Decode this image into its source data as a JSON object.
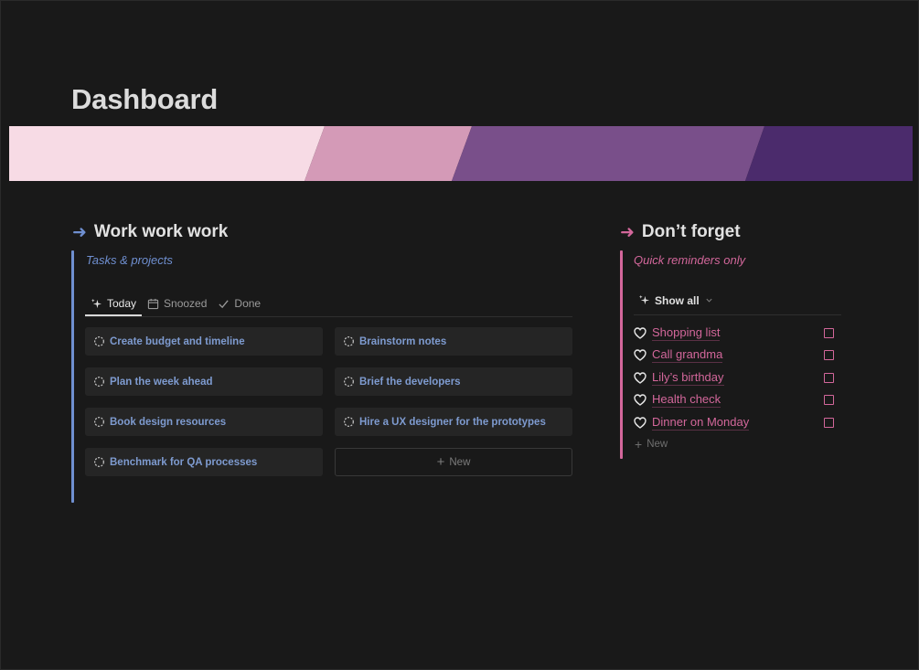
{
  "page": {
    "title": "Dashboard"
  },
  "banner": {
    "colors": [
      "#f7dbe5",
      "#d49ab7",
      "#794f8a",
      "#4b2b6c"
    ]
  },
  "work": {
    "heading": "Work work work",
    "subtitle": "Tasks & projects",
    "accent": "#6f8fd0",
    "arrow_icon": "arrow-right-icon",
    "tabs": [
      {
        "label": "Today",
        "icon": "sparkle-icon",
        "active": true
      },
      {
        "label": "Snoozed",
        "icon": "calendar-icon",
        "active": false
      },
      {
        "label": "Done",
        "icon": "checkmark-icon",
        "active": false
      }
    ],
    "cards": [
      {
        "label": "Create budget and timeline",
        "icon": "dashed-circle-icon"
      },
      {
        "label": "Brainstorm notes",
        "icon": "dashed-circle-icon"
      },
      {
        "label": "Plan the week ahead",
        "icon": "dashed-circle-icon"
      },
      {
        "label": "Brief the developers",
        "icon": "dashed-circle-icon"
      },
      {
        "label": "Book design resources",
        "icon": "dashed-circle-icon"
      },
      {
        "label": "Hire a UX designer for the prototypes",
        "icon": "dashed-circle-icon"
      },
      {
        "label": "Benchmark for QA processes",
        "icon": "dashed-circle-icon"
      }
    ],
    "new_label": "New"
  },
  "reminders": {
    "heading": "Don’t forget",
    "subtitle": "Quick reminders only",
    "accent": "#d3679b",
    "arrow_icon": "arrow-right-icon",
    "filter_label": "Show all",
    "items": [
      {
        "label": "Shopping list",
        "icon": "heart-icon",
        "checked": false
      },
      {
        "label": "Call grandma",
        "icon": "heart-icon",
        "checked": false
      },
      {
        "label": "Lily’s birthday",
        "icon": "heart-icon",
        "checked": false
      },
      {
        "label": "Health check",
        "icon": "heart-icon",
        "checked": false
      },
      {
        "label": "Dinner on Monday",
        "icon": "heart-icon",
        "checked": false
      }
    ],
    "new_label": "New"
  }
}
